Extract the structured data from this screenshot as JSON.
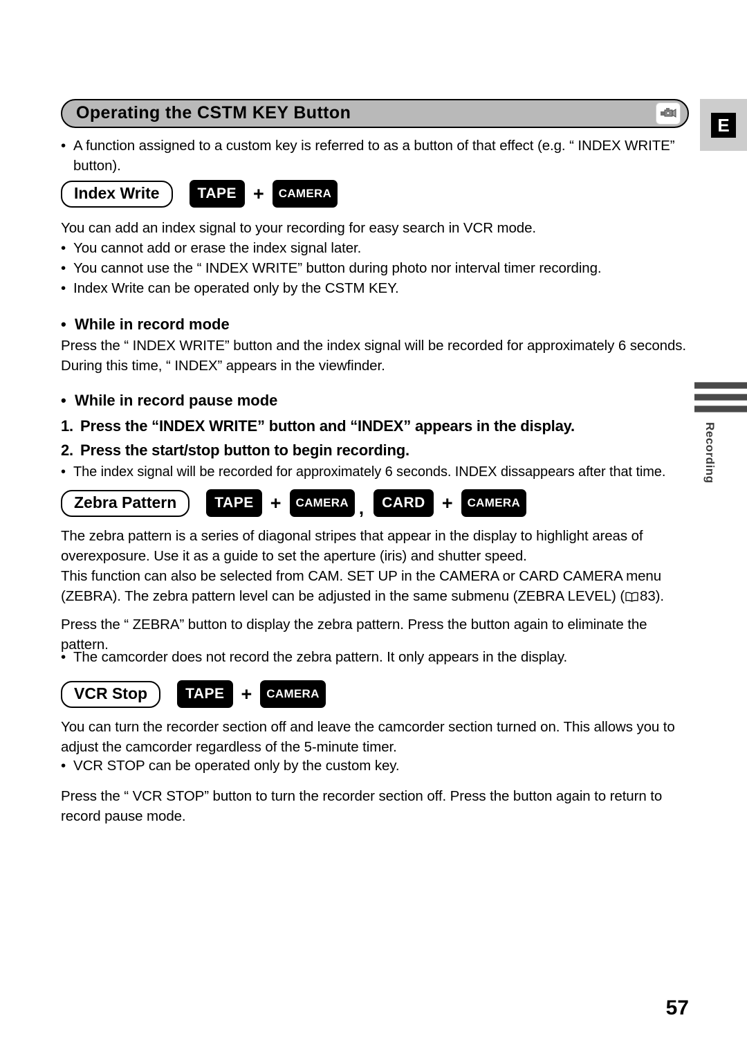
{
  "header": {
    "title": "Operating the CSTM KEY Button",
    "camera_icon": "camcorder-icon",
    "lang_tab": "E"
  },
  "side_tab": {
    "label": "Recording",
    "bar_count": 3
  },
  "intro": {
    "bullet": "•",
    "text": "A function assigned to a custom key is referred to as a button of that effect (e.g. “ INDEX WRITE” button)."
  },
  "sections": [
    {
      "name": "index-write",
      "pill": "Index Write",
      "modes": [
        "TAPE",
        "+",
        "CAMERA"
      ],
      "intro_line": "You can add an index signal to your recording for easy search in VCR mode.",
      "bullets": [
        "You cannot add or erase the index signal later.",
        "You cannot use the “ INDEX WRITE” button during photo nor interval timer recording.",
        "Index Write can be operated only by the CSTM KEY."
      ],
      "sub_head_record": "While in record mode",
      "record_body": "Press the “ INDEX WRITE” button and the index signal will be recorded for approximately 6 seconds. During this time, “ INDEX” appears in the viewfinder.",
      "sub_head_pause": "While in record pause mode",
      "steps": [
        {
          "num": "1.",
          "text": "Press the “INDEX WRITE” button and “INDEX” appears in the display."
        },
        {
          "num": "2.",
          "text": "Press the start/stop button to begin recording."
        }
      ],
      "step_bullet": "The index signal will be recorded for approximately 6 seconds. INDEX dissappears after that time."
    },
    {
      "name": "zebra-pattern",
      "pill": "Zebra Pattern",
      "modes": [
        "TAPE",
        "+",
        "CAMERA",
        ",",
        "CARD",
        "+",
        "CAMERA"
      ],
      "para1": "The zebra pattern is a series of diagonal stripes that appear in the display to highlight areas of overexposure. Use it as a guide to set the aperture (iris) and shutter speed.",
      "para2_a": "This function can also be selected from CAM. SET UP in the CAMERA or CARD CAMERA menu (ZEBRA). The zebra pattern level can be adjusted in the same submenu (ZEBRA LEVEL) (",
      "para2_ref": "83",
      "para2_b": ").",
      "para3": "Press the “ ZEBRA” button to display the zebra pattern. Press the button again to eliminate the pattern.",
      "bullets": [
        "The camcorder does not record the zebra pattern. It only appears in the display."
      ]
    },
    {
      "name": "vcr-stop",
      "pill": "VCR Stop",
      "modes": [
        "TAPE",
        "+",
        "CAMERA"
      ],
      "para1": "You can turn the recorder section off and leave the camcorder section turned on. This allows you to adjust the camcorder regardless of the 5-minute timer.",
      "bullets": [
        "VCR STOP can be operated only by the custom key."
      ],
      "para2": "Press the “ VCR STOP” button to turn the recorder section off. Press the button again to return to record pause mode."
    }
  ],
  "symbols": {
    "bullet": "•",
    "plus": "+",
    "comma": ","
  },
  "page_number": "57",
  "colors": {
    "header_fill": "#b9b9b9",
    "tab_fill": "#cdcdcd",
    "badge_fill": "#000000",
    "side_bar": "#494949"
  }
}
